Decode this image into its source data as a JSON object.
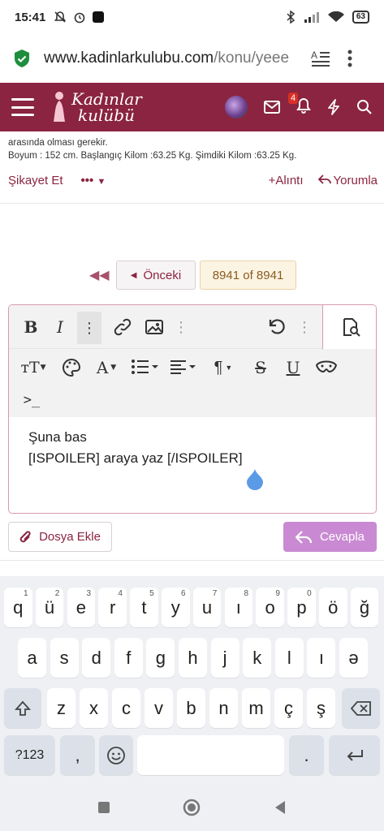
{
  "status_bar": {
    "time": "15:41",
    "battery": "63"
  },
  "browser": {
    "url_domain": "www.kadinlarkulubu.com",
    "url_path": "/konu/yeee"
  },
  "site": {
    "logo_line1": "Kadınlar",
    "logo_line2": "kulübü",
    "notification_count": "4"
  },
  "post": {
    "line1": "arasında olması gerekir.",
    "line2": "Boyum : 152 cm. Başlangıç Kilom :63.25 Kg. Şimdiki Kilom :63.25 Kg.",
    "report_label": "Şikayet Et",
    "more_label": "•••",
    "quote_label": "Alıntı",
    "comment_label": "Yorumla"
  },
  "pagination": {
    "prev_label": "Önceki",
    "page_indicator": "8941 of 8941"
  },
  "editor": {
    "content_line1": "Şuna bas",
    "content_line2": "[ISPOILER] araya yaz [/ISPOILER]"
  },
  "buttons": {
    "attach_label": "Dosya Ekle",
    "reply_label": "Cevapla"
  },
  "keyboard": {
    "row1": [
      {
        "k": "q",
        "s": "1"
      },
      {
        "k": "ü",
        "s": "2"
      },
      {
        "k": "e",
        "s": "3"
      },
      {
        "k": "r",
        "s": "4"
      },
      {
        "k": "t",
        "s": "5"
      },
      {
        "k": "y",
        "s": "6"
      },
      {
        "k": "u",
        "s": "7"
      },
      {
        "k": "ı",
        "s": "8"
      },
      {
        "k": "o",
        "s": "9"
      },
      {
        "k": "p",
        "s": "0"
      },
      {
        "k": "ö",
        "s": ""
      },
      {
        "k": "ğ",
        "s": ""
      }
    ],
    "row2": [
      "a",
      "s",
      "d",
      "f",
      "g",
      "h",
      "j",
      "k",
      "l",
      "ı",
      "ə"
    ],
    "row3": [
      "z",
      "x",
      "c",
      "v",
      "b",
      "n",
      "m",
      "ç",
      "ş"
    ],
    "symbols_label": "?123",
    "comma_label": ",",
    "period_label": "."
  },
  "colors": {
    "brand": "#8a2440",
    "reply_button": "#c98ad3",
    "page_indicator_bg": "#fcf4e2"
  }
}
